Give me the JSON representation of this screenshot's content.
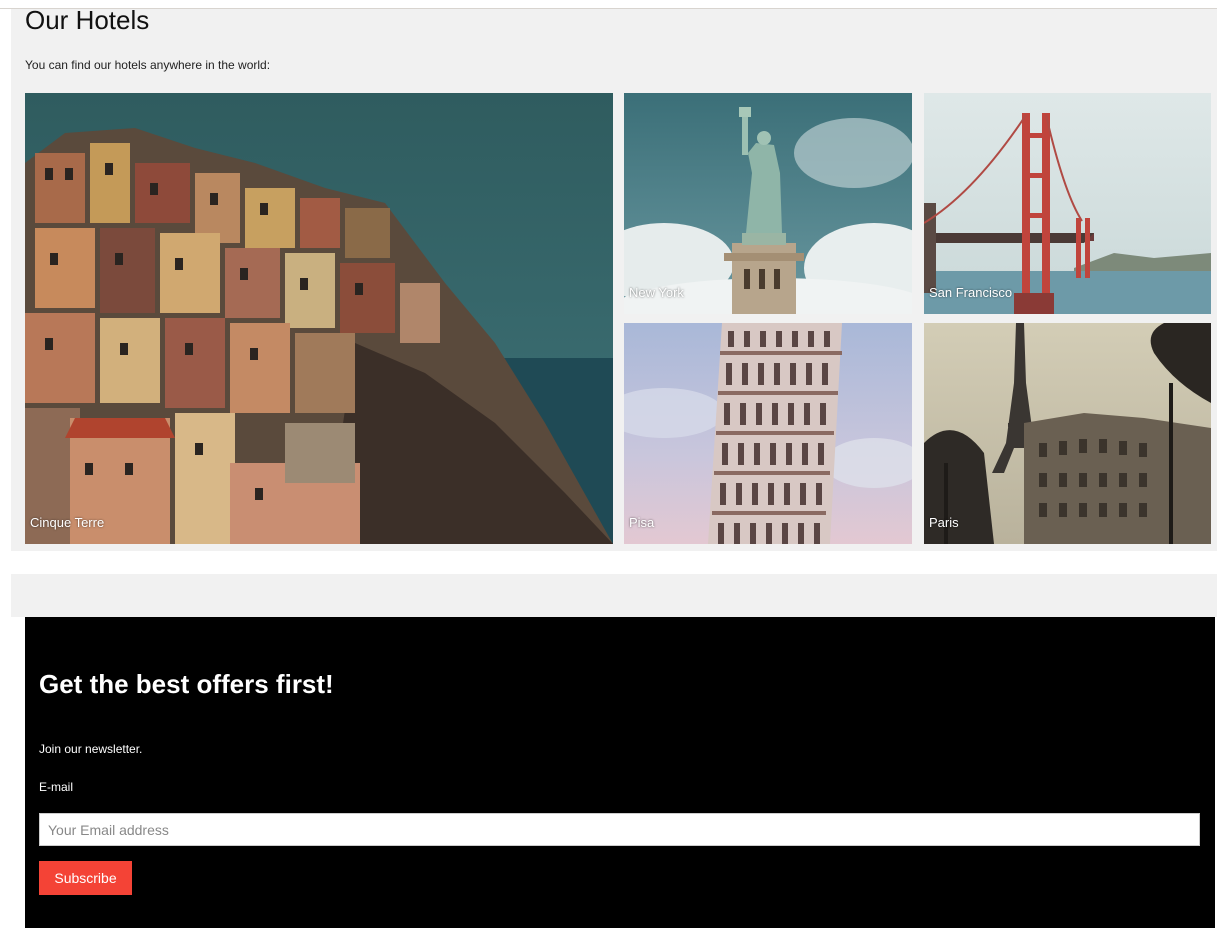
{
  "hotels": {
    "title": "Our Hotels",
    "subtitle": "You can find our hotels anywhere in the world:",
    "destinations": [
      {
        "label": "Cinque Terre",
        "icon": "cinque-terre-photo"
      },
      {
        "label": "New York",
        "icon": "statue-of-liberty-photo"
      },
      {
        "label": "San Francisco",
        "icon": "golden-gate-bridge-photo"
      },
      {
        "label": "Pisa",
        "icon": "leaning-tower-photo"
      },
      {
        "label": "Paris",
        "icon": "eiffel-tower-photo"
      }
    ]
  },
  "newsletter": {
    "heading": "Get the best offers first!",
    "text": "Join our newsletter.",
    "email_label": "E-mail",
    "email_placeholder": "Your Email address",
    "email_value": "",
    "button_label": "Subscribe",
    "button_color": "#f44336",
    "background_color": "#000000"
  }
}
